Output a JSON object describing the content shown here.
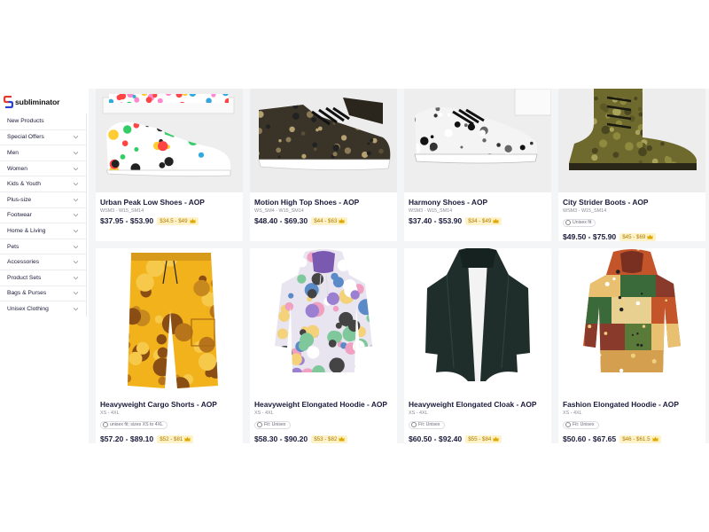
{
  "brand": {
    "name": "subliminator",
    "logo_icon": "subliminator-logo-icon"
  },
  "sidebar": {
    "items": [
      {
        "label": "New Products",
        "chevron": false
      },
      {
        "label": "Special Offers",
        "chevron": true
      },
      {
        "label": "Men",
        "chevron": true
      },
      {
        "label": "Women",
        "chevron": true
      },
      {
        "label": "Kids & Youth",
        "chevron": true
      },
      {
        "label": "Plus-size",
        "chevron": true
      },
      {
        "label": "Footwear",
        "chevron": true
      },
      {
        "label": "Home & Living",
        "chevron": true
      },
      {
        "label": "Pets",
        "chevron": true
      },
      {
        "label": "Accessories",
        "chevron": true
      },
      {
        "label": "Product Sets",
        "chevron": true
      },
      {
        "label": "Bags & Purses",
        "chevron": true
      },
      {
        "label": "Unisex Clothing",
        "chevron": true
      }
    ]
  },
  "products": [
    {
      "title": "Urban Peak Low Shoes - AOP",
      "sku": "WSM3 - W15_SM14",
      "fit": "",
      "price": "$37.95 - $53.90",
      "badge": "$34.5 - $49",
      "image": "low-top-sneaker-colorful-dots"
    },
    {
      "title": "Motion High Top Shoes - AOP",
      "sku": "WS_SM4 - W15_SM14",
      "fit": "",
      "price": "$48.40 - $69.30",
      "badge": "$44 - $63",
      "image": "high-top-sneaker-dark-floral"
    },
    {
      "title": "Harmony Shoes - AOP",
      "sku": "WSM3 - W15_SM14",
      "fit": "",
      "price": "$37.40 - $53.90",
      "badge": "$34 - $49",
      "image": "sneaker-black-white-pattern"
    },
    {
      "title": "City Strider Boots - AOP",
      "sku": "WSM3 - W15_SM14",
      "fit": "Unisex fit",
      "price": "$49.50 - $75.90",
      "badge": "$45 - $69",
      "image": "boots-olive-croc"
    },
    {
      "title": "Heavyweight Cargo Shorts - AOP",
      "sku": "XS - 4XL",
      "fit": "unisex fit; sizes XS to 4XL",
      "price": "$57.20 - $89.10",
      "badge": "$52 - $81",
      "image": "cargo-shorts-yellow-tiedye"
    },
    {
      "title": "Heavyweight Elongated Hoodie - AOP",
      "sku": "XS - 4XL",
      "fit": "Fit: Unisex",
      "price": "$58.30 - $90.20",
      "badge": "$53 - $82",
      "image": "hoodie-pastel-floral"
    },
    {
      "title": "Heavyweight Elongated Cloak - AOP",
      "sku": "XS - 4XL",
      "fit": "Fit: Unisex",
      "price": "$60.50 - $92.40",
      "badge": "$55 - $84",
      "image": "cloak-dark-green"
    },
    {
      "title": "Fashion Elongated Hoodie - AOP",
      "sku": "XS - 4XL",
      "fit": "Fit: Unisex",
      "price": "$50.60 - $67.65",
      "badge": "$46 - $61.5",
      "image": "hoodie-patchwork-ethnic"
    }
  ],
  "colors": {
    "badge_bg": "#fdf2c8",
    "badge_text": "#b07c00",
    "logo_red": "#e8392d",
    "logo_blue": "#2a3fd6"
  }
}
